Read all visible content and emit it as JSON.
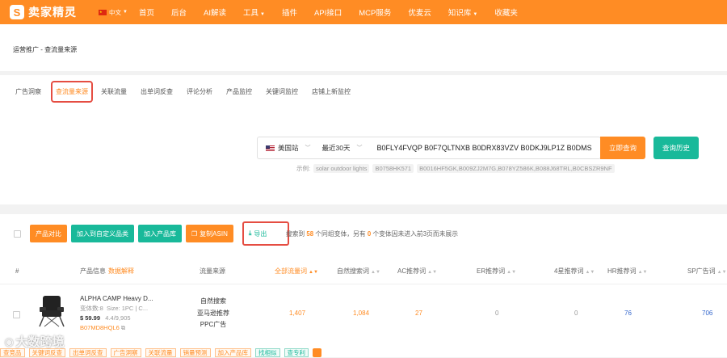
{
  "brand": {
    "name": "卖家精灵",
    "mark": "S"
  },
  "lang": "中文",
  "nav": [
    "首页",
    "后台",
    "AI解读",
    "工具",
    "插件",
    "API接口",
    "MCP服务",
    "优麦云",
    "知识库",
    "收藏夹"
  ],
  "breadcrumb": "运营推广 - 查流量来源",
  "tabs": [
    "广告洞察",
    "查流量来源",
    "关联流量",
    "出单词反查",
    "评论分析",
    "产品监控",
    "关键词监控",
    "店铺上新监控"
  ],
  "search": {
    "site": "美国站",
    "range": "最近30天",
    "asins": "B0FLY4FVQP B0F7QLTNXB B0DRX83VZV B0DKJ9LP1Z B0DMS",
    "query_label": "立即查询",
    "history_label": "查询历史",
    "examples_label": "示例:",
    "examples": [
      "solar outdoor lights",
      "B0758HK571",
      "B0016HF5GK,B009ZJ2M7G,B078YZ586K,B088J68TRL,B0CBSZR9NF"
    ]
  },
  "toolbar": {
    "compare": "产品对比",
    "add_category": "加入到自定义品类",
    "add_library": "加入产品库",
    "copy_asin": "复制ASIN",
    "export": "导出",
    "summary_prefix": "搜索到",
    "summary_count": "58",
    "summary_mid": "个同组变体，另有",
    "summary_zero": "0",
    "summary_suffix": "个变体因未进入前3页而未展示"
  },
  "table": {
    "headers": {
      "index": "#",
      "product": "产品信息",
      "product_tip": "数据解释",
      "source": "流量来源",
      "total": "全部流量词",
      "organic": "自然搜索词",
      "ac": "AC推荐词",
      "er": "ER推荐词",
      "star4": "4星推荐词",
      "hr": "HR推荐词",
      "sp": "SP广告词"
    },
    "rows": [
      {
        "title": "ALPHA CAMP Heavy D...",
        "variants": "变体数:8",
        "size": "Size: 1PC | C...",
        "price": "$ 59.99",
        "rating": "4.4/9,905",
        "asin": "B07MD8HQL6",
        "sources": [
          "自然搜索",
          "亚马逊推荐",
          "PPC广告"
        ],
        "total": "1,407",
        "organic": "1,084",
        "ac": "27",
        "er": "0",
        "star4": "0",
        "hr": "76",
        "sp": "706"
      }
    ]
  },
  "row_actions": [
    "查竞品",
    "关键词反查",
    "出单词反查",
    "广告洞察",
    "关联流量",
    "销量预测",
    "加入产品库",
    "找相似",
    "查专利"
  ],
  "watermark": "大数跨境"
}
